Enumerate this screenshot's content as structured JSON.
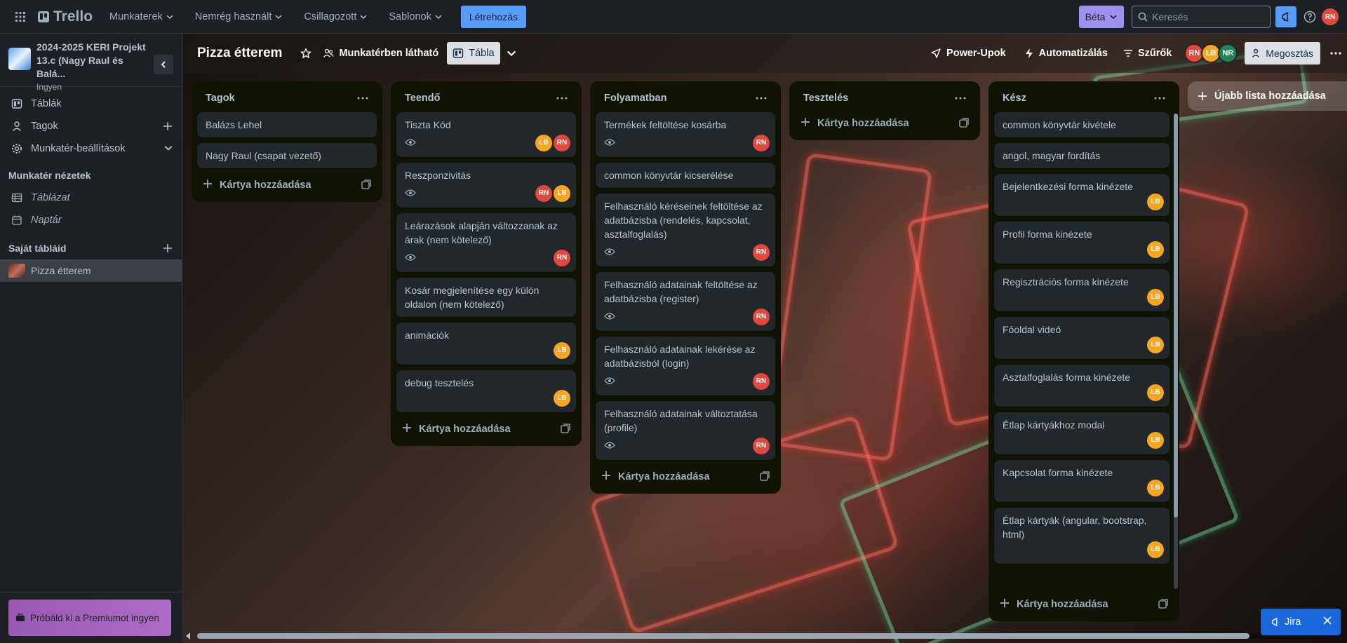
{
  "topnav": {
    "brand": "Trello",
    "menus": [
      {
        "label": "Munkaterek"
      },
      {
        "label": "Nemrég használt"
      },
      {
        "label": "Csillagozott"
      },
      {
        "label": "Sablonok"
      }
    ],
    "create_label": "Létrehozás",
    "beta_label": "Béta",
    "search_placeholder": "Keresés",
    "user_initials": "RN"
  },
  "sidebar": {
    "workspace_name": "2024-2025 KERI Projekt 13.c (Nagy Raul és Balá...",
    "workspace_plan": "Ingyen",
    "items": [
      {
        "label": "Táblák"
      },
      {
        "label": "Tagok"
      },
      {
        "label": "Munkatér-beállítások"
      }
    ],
    "views_heading": "Munkatér nézetek",
    "views": [
      {
        "label": "Táblázat"
      },
      {
        "label": "Naptár"
      }
    ],
    "boards_heading": "Saját tábláid",
    "boards": [
      {
        "label": "Pizza étterem"
      }
    ],
    "premium_label": "Próbáld ki a Premiumot ingyen"
  },
  "board_header": {
    "title": "Pizza étterem",
    "visibility_label": "Munkatérben látható",
    "view_label": "Tábla",
    "powerups_label": "Power-Upok",
    "automation_label": "Automatizálás",
    "filters_label": "Szűrők",
    "members": [
      "RN",
      "LB",
      "NR"
    ],
    "share_label": "Megosztás"
  },
  "lists": [
    {
      "title": "Tagok",
      "cards": [
        {
          "title": "Balázs Lehel",
          "watch": false,
          "members": []
        },
        {
          "title": "Nagy Raul (csapat vezető)",
          "watch": false,
          "members": []
        }
      ],
      "add_label": "Kártya hozzáadása"
    },
    {
      "title": "Teendő",
      "cards": [
        {
          "title": "Tiszta Kód",
          "watch": true,
          "members": [
            "LB",
            "RN"
          ]
        },
        {
          "title": "Reszponzivitás",
          "watch": true,
          "members": [
            "RN",
            "LB"
          ]
        },
        {
          "title": "Leárazások alapján változzanak az árak (nem kötelező)",
          "watch": true,
          "members": [
            "RN"
          ]
        },
        {
          "title": "Kosár megjelenítése egy külön oldalon (nem kötelező)",
          "watch": false,
          "members": []
        },
        {
          "title": "animációk",
          "watch": false,
          "members": [
            "LB"
          ]
        },
        {
          "title": "debug tesztelés",
          "watch": false,
          "members": [
            "LB"
          ]
        }
      ],
      "add_label": "Kártya hozzáadása"
    },
    {
      "title": "Folyamatban",
      "cards": [
        {
          "title": "Termékek feltöltése kosárba",
          "watch": true,
          "members": [
            "RN"
          ]
        },
        {
          "title": "common könyvtár kicserélése",
          "watch": false,
          "members": []
        },
        {
          "title": "Felhasználó kéréseinek feltöltése az adatbázisba (rendelés, kapcsolat, asztalfoglalás)",
          "watch": true,
          "members": [
            "RN"
          ]
        },
        {
          "title": "Felhasználó adatainak feltöltése az adatbázisba (register)",
          "watch": true,
          "members": [
            "RN"
          ]
        },
        {
          "title": "Felhasználó adatainak lekérése az adatbázisból (login)",
          "watch": true,
          "members": [
            "RN"
          ]
        },
        {
          "title": "Felhasználó adatainak változtatása (profile)",
          "watch": true,
          "members": [
            "RN"
          ]
        }
      ],
      "add_label": "Kártya hozzáadása"
    },
    {
      "title": "Tesztelés",
      "cards": [],
      "add_label": "Kártya hozzáadása"
    },
    {
      "title": "Kész",
      "cards": [
        {
          "title": "common könyvtár kivétele",
          "watch": false,
          "members": []
        },
        {
          "title": "angol, magyar fordítás",
          "watch": false,
          "members": []
        },
        {
          "title": "Bejelentkezési forma kinézete",
          "watch": false,
          "members": [
            "LB"
          ]
        },
        {
          "title": "Profil forma kinézete",
          "watch": false,
          "members": [
            "LB"
          ]
        },
        {
          "title": "Regisztrációs forma kinézete",
          "watch": false,
          "members": [
            "LB"
          ]
        },
        {
          "title": "Fóoldal videó",
          "watch": false,
          "members": [
            "LB"
          ]
        },
        {
          "title": "Asztalfoglalás forma kinézete",
          "watch": false,
          "members": [
            "LB"
          ]
        },
        {
          "title": "Étlap kártyákhoz modal",
          "watch": false,
          "members": [
            "LB"
          ]
        },
        {
          "title": "Kapcsolat forma kinézete",
          "watch": false,
          "members": [
            "LB"
          ]
        },
        {
          "title": "Étlap kártyák (angular, bootstrap, html)",
          "watch": false,
          "members": [
            "LB"
          ]
        }
      ],
      "add_label": "Kártya hozzáadása"
    }
  ],
  "add_list_label": "Újabb lista hozzáadása",
  "jira_label": "Jira",
  "colors": {
    "accent": "#579dff",
    "beta": "#9f8fef",
    "avatar_rn": "#e2483d",
    "avatar_lb": "#f5a623",
    "avatar_nr": "#1f845a",
    "list_bg": "#101204",
    "card_bg": "#22272b"
  }
}
